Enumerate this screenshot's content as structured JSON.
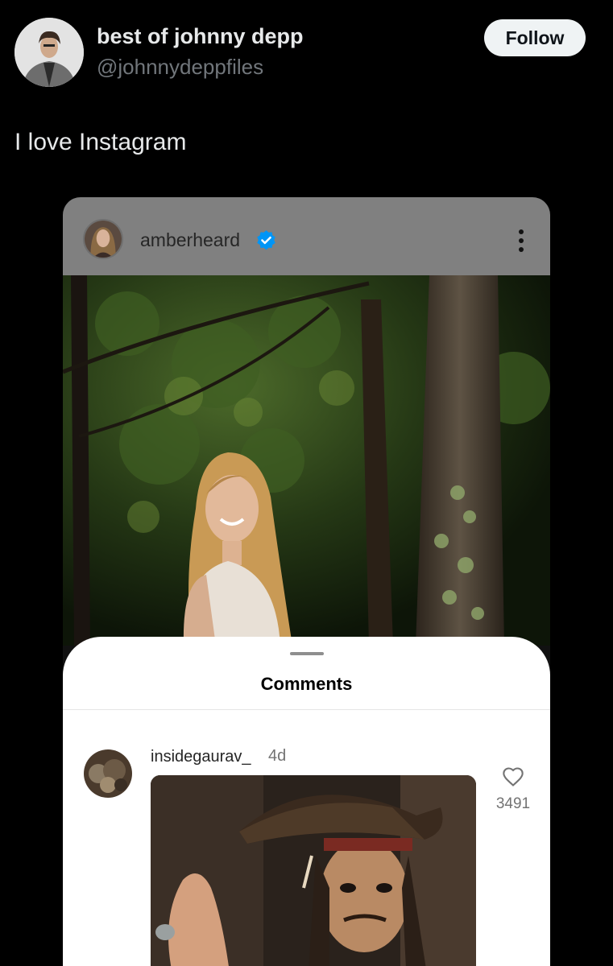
{
  "tweet": {
    "display_name": "best of johnny depp",
    "handle": "@johnnydeppfiles",
    "follow_label": "Follow",
    "text": "I love Instagram"
  },
  "instagram": {
    "username": "amberheard",
    "verified": true,
    "comments_sheet": {
      "title": "Comments",
      "comments": [
        {
          "username": "insidegaurav_",
          "age": "4d",
          "like_count": "3491"
        }
      ]
    }
  },
  "colors": {
    "background": "#000000",
    "follow_button": "#eff3f4",
    "verified_badge": "#0095f6",
    "ig_header": "#808080"
  },
  "icons": [
    "verified-badge-icon",
    "more-options-icon",
    "heart-icon"
  ]
}
